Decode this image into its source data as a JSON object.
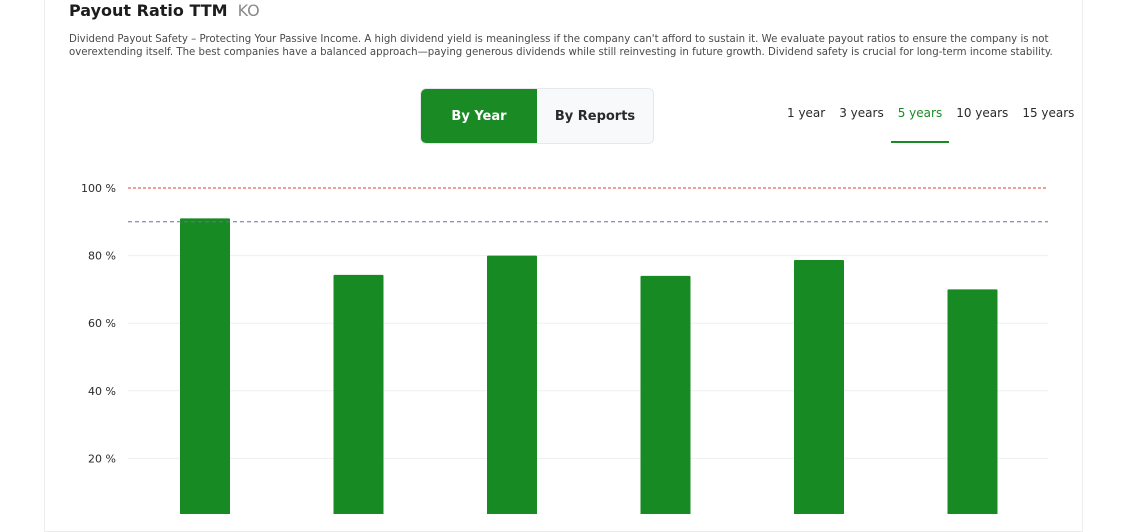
{
  "header": {
    "title": "Payout Ratio TTM",
    "ticker": "KO"
  },
  "description": "Dividend Payout Safety – Protecting Your Passive Income. A high dividend yield is meaningless if the company can't afford to sustain it. We evaluate payout ratios to ensure the company is not overextending itself. The best companies have a balanced approach—paying generous dividends while still reinvesting in future growth. Dividend safety is crucial for long-term income stability.",
  "view_toggle": {
    "options": [
      "By Year",
      "By Reports"
    ],
    "selected": "By Year"
  },
  "ranges": {
    "options": [
      "1 year",
      "3 years",
      "5 years",
      "10 years",
      "15 years"
    ],
    "selected": "5 years"
  },
  "colors": {
    "accent": "#1a8a25",
    "bar": "#188a24",
    "limit_line": "#e0403a",
    "average_line": "#6e6e99",
    "grid": "#efefef"
  },
  "chart_data": {
    "type": "bar",
    "values": [
      91,
      74.3,
      80,
      74,
      78.7,
      70
    ],
    "ylim": [
      0,
      100
    ],
    "y_ticks": [
      {
        "value": 20,
        "label": "20 %"
      },
      {
        "value": 40,
        "label": "40 %"
      },
      {
        "value": 60,
        "label": "60 %"
      },
      {
        "value": 80,
        "label": "80 %"
      },
      {
        "value": 100,
        "label": "100 %"
      }
    ],
    "reference_lines": [
      {
        "value": 100,
        "style": "dashed",
        "color": "#e0403a"
      },
      {
        "value": 90,
        "style": "dashed",
        "color": "#6e6e99"
      }
    ],
    "grid": true
  }
}
